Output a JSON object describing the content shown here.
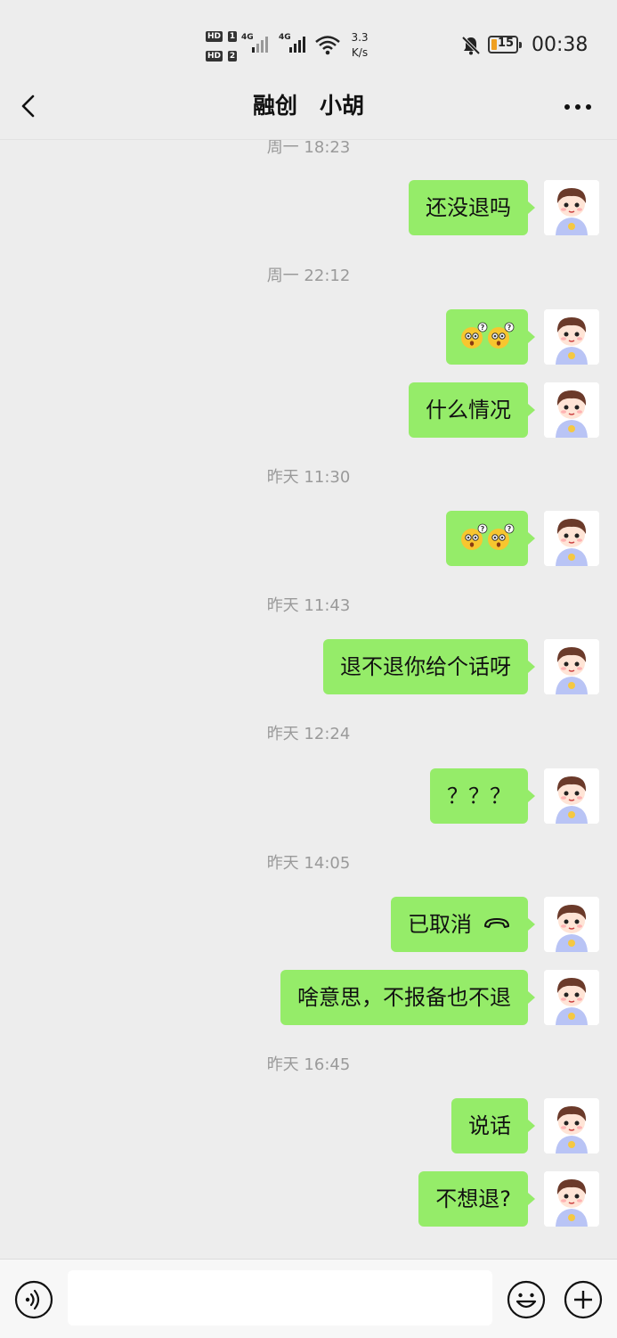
{
  "status_bar": {
    "sim1": "HD",
    "sim1_num": "1",
    "sim2": "HD",
    "sim2_num": "2",
    "net1": "4G",
    "net2": "4G",
    "speed_value": "3.3",
    "speed_unit": "K/s",
    "battery": "15",
    "time": "00:38",
    "icons": [
      "mute-bell-icon",
      "wifi-icon",
      "signal-icon",
      "battery-icon"
    ]
  },
  "header": {
    "title": "融创　小胡",
    "back_icon": "chevron-left-icon",
    "more_icon": "more-dots-icon"
  },
  "chat": {
    "items": [
      {
        "type": "time",
        "text": "周一 18:23"
      },
      {
        "type": "message",
        "text": "还没退吗",
        "sender": "me"
      },
      {
        "type": "time",
        "text": "周一 22:12"
      },
      {
        "type": "message",
        "emoji": [
          "confused-emoji",
          "confused-emoji"
        ],
        "sender": "me"
      },
      {
        "type": "message",
        "text": "什么情况",
        "sender": "me"
      },
      {
        "type": "time",
        "text": "昨天 11:30"
      },
      {
        "type": "message",
        "emoji": [
          "confused-emoji",
          "confused-emoji"
        ],
        "sender": "me"
      },
      {
        "type": "time",
        "text": "昨天 11:43"
      },
      {
        "type": "message",
        "text": "退不退你给个话呀",
        "sender": "me"
      },
      {
        "type": "time",
        "text": "昨天 12:24"
      },
      {
        "type": "message",
        "text": "？？？",
        "sender": "me"
      },
      {
        "type": "time",
        "text": "昨天 14:05"
      },
      {
        "type": "call",
        "text": "已取消",
        "icon": "hangup-icon",
        "sender": "me"
      },
      {
        "type": "message",
        "text": "啥意思，不报备也不退",
        "sender": "me"
      },
      {
        "type": "time",
        "text": "昨天 16:45"
      },
      {
        "type": "message",
        "text": "说话",
        "sender": "me"
      },
      {
        "type": "message",
        "text": "不想退?",
        "sender": "me"
      }
    ]
  },
  "input_bar": {
    "placeholder": "",
    "value": "",
    "icons": [
      "voice-icon",
      "emoji-icon",
      "plus-icon"
    ]
  },
  "colors": {
    "background": "#ededed",
    "bubble": "#95ec69",
    "time_text": "#9a9a9a"
  }
}
